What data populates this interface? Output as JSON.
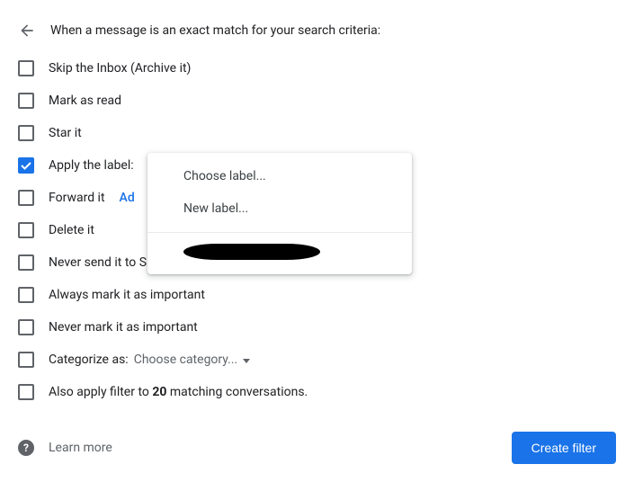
{
  "header": {
    "title": "When a message is an exact match for your search criteria:"
  },
  "options": {
    "skip_inbox": "Skip the Inbox (Archive it)",
    "mark_read": "Mark as read",
    "star": "Star it",
    "apply_label": "Apply the label:",
    "forward": "Forward it",
    "forward_link": "Ad",
    "delete": "Delete it",
    "never_spam": "Never send it to Spam",
    "always_important": "Always mark it as important",
    "never_important": "Never mark it as important",
    "categorize_prefix": "Categorize as:",
    "categorize_select": "Choose category...",
    "also_apply_prefix": "Also apply filter to ",
    "also_apply_count": "20",
    "also_apply_suffix": " matching conversations."
  },
  "popup": {
    "choose": "Choose label...",
    "new_label": "New label...",
    "existing_label": ""
  },
  "footer": {
    "learn_more": "Learn more",
    "create": "Create filter"
  }
}
